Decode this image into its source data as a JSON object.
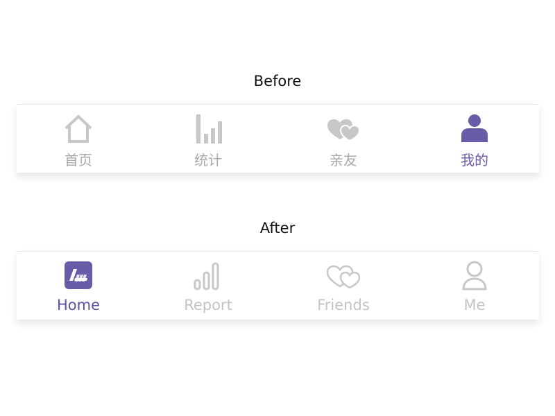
{
  "before": {
    "title": "Before",
    "tabs": [
      {
        "label": "首页",
        "icon": "home-icon",
        "active": false
      },
      {
        "label": "统计",
        "icon": "bar-chart-icon",
        "active": false
      },
      {
        "label": "亲友",
        "icon": "hearts-icon",
        "active": false
      },
      {
        "label": "我的",
        "icon": "user-icon",
        "active": true
      }
    ]
  },
  "after": {
    "title": "After",
    "tabs": [
      {
        "label": "Home",
        "icon": "home-app-icon",
        "active": true
      },
      {
        "label": "Report",
        "icon": "report-bars-icon",
        "active": false
      },
      {
        "label": "Friends",
        "icon": "hearts-outline-icon",
        "active": false
      },
      {
        "label": "Me",
        "icon": "user-outline-icon",
        "active": false
      }
    ]
  },
  "colors": {
    "accent": "#6a5ba8",
    "inactive_icon": "#c7c7c7",
    "inactive_label_before": "#a9a9a9",
    "inactive_label_after": "#c3c3c3"
  }
}
